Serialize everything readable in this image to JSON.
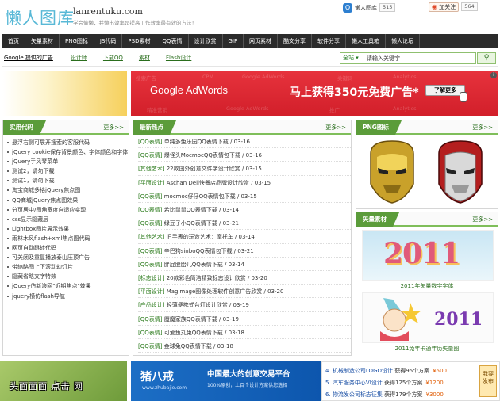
{
  "header": {
    "logo_text": "懒人图库",
    "domain": "lanrentuku.com",
    "slogan": "学会偷懒，并懒出效率是提高工作效率最有效的方法！",
    "qq_share": {
      "label": "懒人图库",
      "count": "515"
    },
    "weibo": {
      "label": "加关注",
      "count": "564"
    }
  },
  "nav": {
    "items": [
      "首页",
      "矢量素材",
      "PNG图标",
      "JS代码",
      "PSD素材",
      "QQ表情",
      "设计欣赏",
      "GIF",
      "网页素材",
      "酷文分享",
      "软件分享",
      "懒人工具箱",
      "懒人论坛"
    ]
  },
  "subnav": {
    "items": [
      "Google 提供的广告",
      "设计师",
      "下载QQ",
      "素材",
      "Flash设计"
    ],
    "search_select": "全站",
    "search_value": "请输入关键字",
    "search_button_icon": "search-icon"
  },
  "ad": {
    "brand": "Google AdWords",
    "headline": "马上获得350元免费广告*",
    "button": "了解更多",
    "info": "i",
    "bg_words": [
      "搜索广告",
      "CPM",
      "Google AdWords",
      "关键词",
      "Analytics",
      "精准营销",
      "推广"
    ]
  },
  "code_panel": {
    "title": "实用代码",
    "more": "更多>>",
    "items": [
      "悬浮右侧可展开搜索的客服代码",
      "jQuery cookie保存背景颜色、字体颜色和字体",
      "jQuery手风琴菜单",
      "测试2，请勿下载",
      "测试1，请勿下载",
      "淘宝商城多格jQuery焦点图",
      "QQ商城jQuery焦点图效果",
      "分页居中/图角宽度自适应实现",
      "css显示隐藏层",
      "Lightbox图片展示效果",
      "雨林木风flash+xml焦点图代码",
      "网页自动跳转代码",
      "可关闭及重复播放泰山压顶广告",
      "带缩略图上下滚动幻灯片",
      "隐藏省略文字特效",
      "jQuery仿新浪网\"近期焦点\"效果",
      "jquery横仿flash导航"
    ]
  },
  "hot_panel": {
    "title": "最新热点",
    "more": "更多>>",
    "items": [
      {
        "cat": "[QQ表情]",
        "title": "单纯多兔乐园QQ表情下载",
        "date": "03-16"
      },
      {
        "cat": "[QQ表情]",
        "title": "爆怪头MocmocQQ表情包下载",
        "date": "03-16"
      },
      {
        "cat": "[其他艺术]",
        "title": "22款国外创意文件字设计欣赏",
        "date": "03-15"
      },
      {
        "cat": "[平面设计]",
        "title": "Aschan Dell快餐店品牌设计欣赏",
        "date": "03-15"
      },
      {
        "cat": "[QQ表情]",
        "title": "mocmoc仔仔QQ表情包下载",
        "date": "03-15"
      },
      {
        "cat": "[QQ表情]",
        "title": "若比鼠鼠QQ表情下载",
        "date": "03-14"
      },
      {
        "cat": "[QQ表情]",
        "title": "绿豆子小QQ表情下载",
        "date": "03-21"
      },
      {
        "cat": "[其他艺术]",
        "title": "旧手表的玩造艺术：摩托车",
        "date": "03-14"
      },
      {
        "cat": "[QQ表情]",
        "title": "辛巴狗sinboQQ表情包下载",
        "date": "03-21"
      },
      {
        "cat": "[QQ表情]",
        "title": "胖屁股胎儿QQ表情下载",
        "date": "03-14"
      },
      {
        "cat": "[标志设计]",
        "title": "20款彩色简洁精致标志设计欣赏",
        "date": "03-20"
      },
      {
        "cat": "[平面设计]",
        "title": "Magimage图像处理软件创意广告欣赏",
        "date": "03-20"
      },
      {
        "cat": "[产品设计]",
        "title": "轻薄便携式台灯设计欣赏",
        "date": "03-19"
      },
      {
        "cat": "[QQ表情]",
        "title": "魔魔家族QQ表情下载",
        "date": "03-19"
      },
      {
        "cat": "[QQ表情]",
        "title": "可爱鱼丸兔QQ表情下载",
        "date": "03-18"
      },
      {
        "cat": "[QQ表情]",
        "title": "金球兔QQ表情下载",
        "date": "03-18"
      }
    ]
  },
  "png_panel": {
    "title": "PNG图标",
    "more": "更多>>"
  },
  "vector_panel": {
    "title": "矢量素材",
    "more": "更多>>",
    "items": [
      {
        "caption": "2011年矢量数字字体",
        "art": "2011"
      },
      {
        "caption": "2011兔年卡通年历矢量图",
        "art": "2011"
      }
    ]
  },
  "bottom": {
    "watermark": "头面面面 点击  网",
    "zbj": {
      "logo": "猪八戒",
      "url": "www.zhubajie.com",
      "title": "中国最大的创意交易平台",
      "sub": "100%原创，上百个设计方案供您选择"
    },
    "tasks": [
      {
        "title": "4. 机械制造公司LOGO设计",
        "info": "获得95个方案",
        "price": "¥500"
      },
      {
        "title": "5. 汽车服务中心VI设计",
        "info": "获得125个方案",
        "price": "¥1200"
      },
      {
        "title": "6. 物流发公司标志征集",
        "info": "获得179个方案",
        "price": "¥3000"
      }
    ],
    "post_button": "我要发布"
  },
  "colors": {
    "accent_green": "#5b9c3a",
    "nav_bg": "#2b2b2b",
    "ad_red": "#d21f2a",
    "logo_blue": "#58b8d6"
  }
}
